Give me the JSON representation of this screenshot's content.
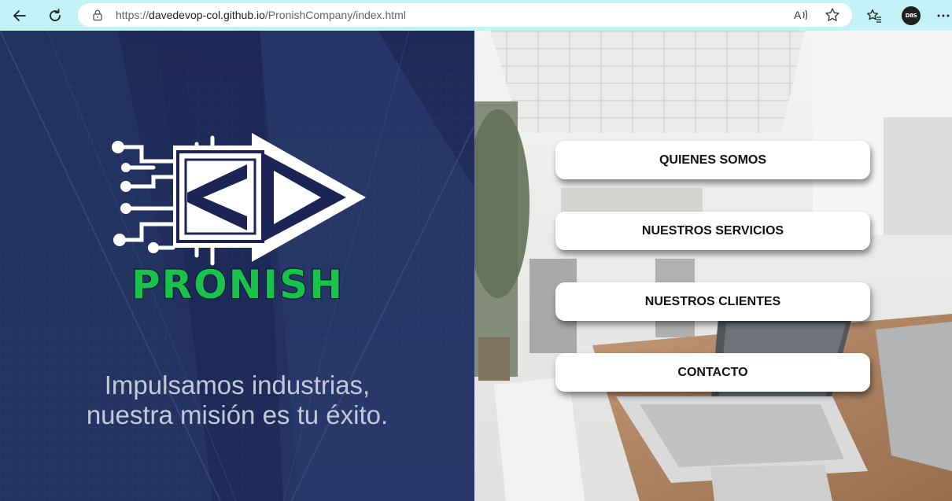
{
  "browser": {
    "url_prefix": "https://",
    "url_host": "davedevop-col.github.io",
    "url_path": "/PronishCompany/index.html",
    "read_aloud_glyph": "A",
    "profile_initials": "D8S"
  },
  "hero": {
    "brand": "PRONISH",
    "tagline_line1": "Impulsamos industrias,",
    "tagline_line2": "nuestra misión es tu éxito."
  },
  "menu": {
    "items": [
      {
        "label": "QUIENES SOMOS"
      },
      {
        "label": "NUESTROS SERVICIOS"
      },
      {
        "label": "NUESTROS CLIENTES"
      },
      {
        "label": "CONTACTO"
      }
    ]
  },
  "colors": {
    "toolbar": "#c3f3f6",
    "left_panel": "#24325f",
    "brand_green": "#19c24a",
    "logo_chevron": "#1c2456"
  },
  "icons": {
    "back": "back-arrow-icon",
    "reload": "reload-icon",
    "lock": "lock-icon",
    "read_aloud": "read-aloud-icon",
    "favorite": "star-icon",
    "favorites": "favorites-icon",
    "more": "more-icon"
  }
}
